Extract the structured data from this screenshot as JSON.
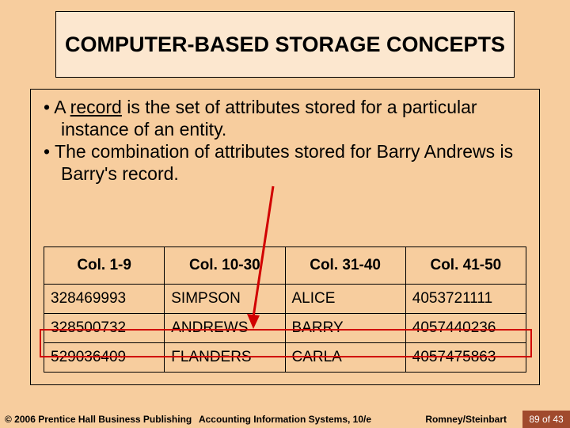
{
  "title": "COMPUTER-BASED STORAGE CONCEPTS",
  "bullets": [
    "A record is the set of attributes stored for a particular instance of an entity.",
    "The combination of attributes stored for Barry Andrews is Barry's record."
  ],
  "table": {
    "headers": [
      "Col. 1-9",
      "Col. 10-30",
      "Col. 31-40",
      "Col. 41-50"
    ],
    "rows": [
      [
        "328469993",
        "SIMPSON",
        "ALICE",
        "4053721111"
      ],
      [
        "328500732",
        "ANDREWS",
        "BARRY",
        "4057440236"
      ],
      [
        "529036409",
        "FLANDERS",
        "CARLA",
        "4057475863"
      ]
    ],
    "highlight_row_index": 1
  },
  "footer": {
    "left": "© 2006 Prentice Hall Business Publishing",
    "center": "Accounting Information Systems, 10/e",
    "right": "Romney/Steinbart",
    "page": "89 of 43"
  }
}
